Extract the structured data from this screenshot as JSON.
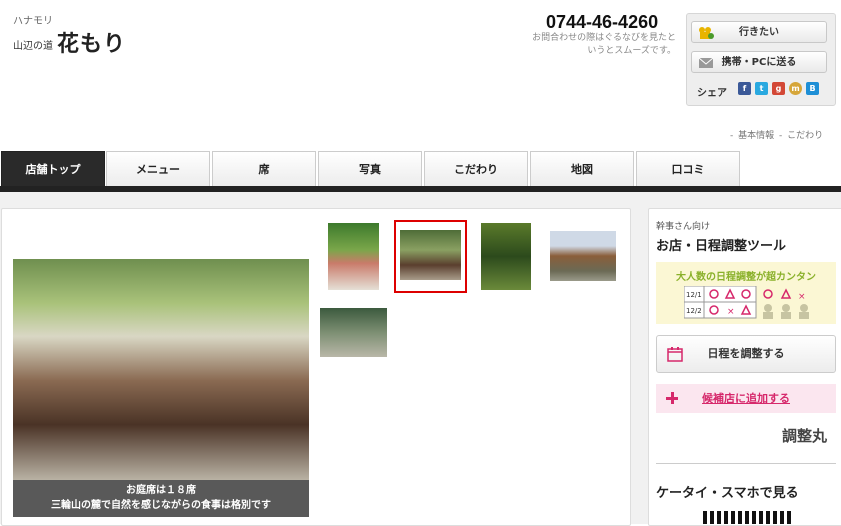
{
  "header": {
    "kana": "ハナモリ",
    "area": "山辺の道",
    "name": "花もり",
    "phone": "0744-46-4260",
    "phone_note": "お問合わせの際はぐるなびを見たというとスムーズです。"
  },
  "actions": {
    "want_label": "行きたい",
    "send_label": "携帯・PCに送る",
    "share_label": "シェア",
    "share_icons": [
      "facebook-icon",
      "twitter-icon",
      "google-plus-icon",
      "mixi-icon",
      "hatena-icon"
    ]
  },
  "sublinks": [
    "基本情報",
    "こだわり"
  ],
  "tabs": [
    "店舗トップ",
    "メニュー",
    "席",
    "写真",
    "こだわり",
    "地図",
    "口コミ"
  ],
  "photo": {
    "caption_line1": "お庭席は１８席",
    "caption_line2": "三輪山の麓で自然を感じながらの食事は格別です"
  },
  "sidebar": {
    "sub": "幹事さん向け",
    "title": "お店・日程調整ツール",
    "promo": "大人数の日程調整が超カンタン",
    "promo_dates": [
      "12/1",
      "12/2"
    ],
    "schedule_button": "日程を調整する",
    "add_candidate": "候補店に追加する",
    "logo": "調整丸",
    "mobile_title": "ケータイ・スマホで見る"
  },
  "colors": {
    "tab_active": "#2a2a2a",
    "accent_pink": "#d6286b",
    "promo_green": "#8ab12a",
    "selected_thumb": "#d00000"
  }
}
